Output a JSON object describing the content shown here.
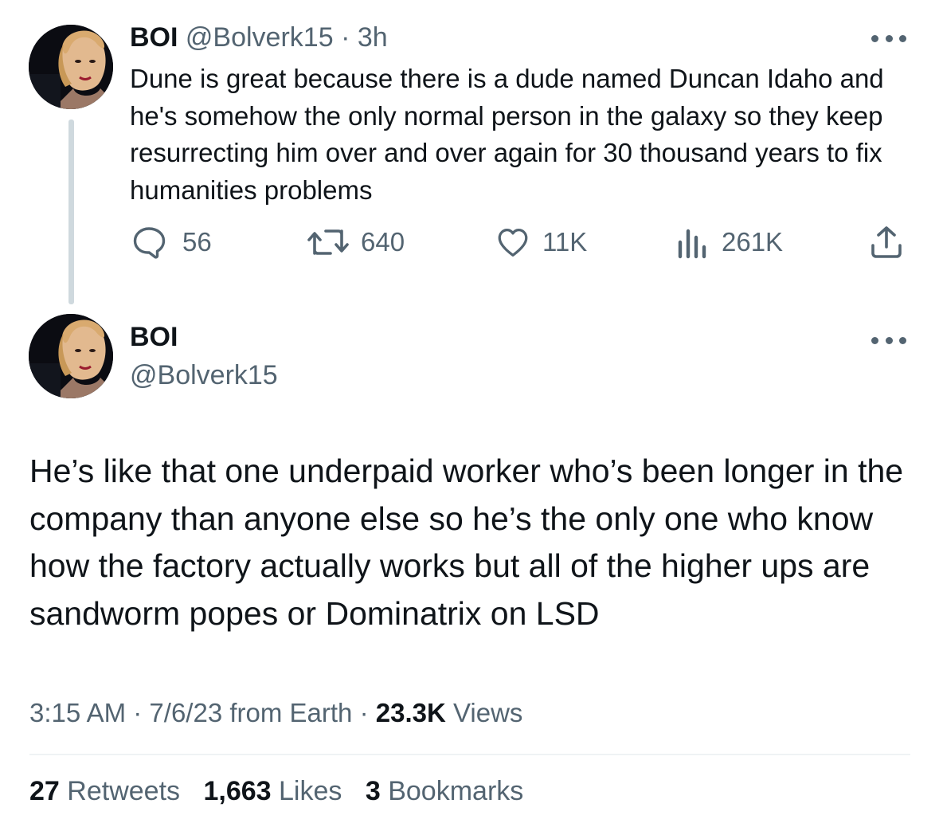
{
  "tweet1": {
    "display_name": "BOI",
    "handle": "@Bolverk15",
    "separator": "·",
    "time_ago": "3h",
    "text": "Dune is great because there is a dude named Duncan Idaho and he's somehow the only normal person in the galaxy so they keep resurrecting him over and over again for 30 thousand years to fix humanities problems",
    "actions": {
      "replies": "56",
      "retweets": "640",
      "likes": "11K",
      "views": "261K"
    },
    "icons": [
      "reply-icon",
      "retweet-icon",
      "like-icon",
      "views-icon",
      "share-icon",
      "more-icon"
    ]
  },
  "tweet2": {
    "display_name": "BOI",
    "handle": "@Bolverk15",
    "text": "He’s like that one underpaid worker who’s been longer in the company than anyone else so he’s the only one who know how the factory actually works but all of the higher ups are sandworm popes or Dominatrix on LSD",
    "meta": {
      "time": "3:15 AM",
      "sep1": "·",
      "date": "7/6/23",
      "source": "from Earth",
      "sep2": "·",
      "views_count": "23.3K",
      "views_label": "Views"
    },
    "stats": {
      "retweets_count": "27",
      "retweets_label": "Retweets",
      "likes_count": "1,663",
      "likes_label": "Likes",
      "bookmarks_count": "3",
      "bookmarks_label": "Bookmarks"
    }
  },
  "colors": {
    "text_primary": "#0f1419",
    "text_secondary": "#536471",
    "thread_line": "#cfd9de",
    "divider": "#eff3f4"
  }
}
